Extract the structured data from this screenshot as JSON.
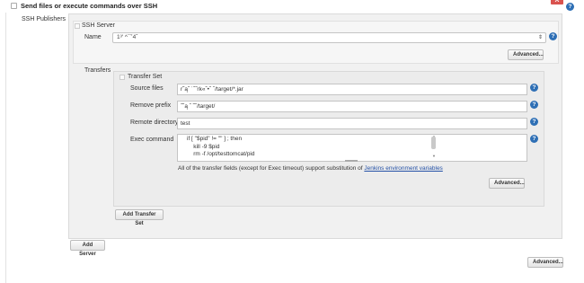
{
  "header": {
    "title": "Send files or execute commands over SSH",
    "close_label": "X"
  },
  "publishers": {
    "label": "SSH Publishers"
  },
  "server": {
    "title": "SSH Server",
    "name_label": "Name",
    "name_value": "1³' ^¯˚4ˆ",
    "advanced_label": "Advanced..."
  },
  "transfers": {
    "label": "Transfers",
    "set_title": "Transfer Set",
    "source_label": "Source files",
    "source_value": "r˜ąˆ ˙ˆ˝rk«ˆ•ˆ ˆ/target/*.jar",
    "remove_label": "Remove prefix",
    "remove_value": "˝ˆą ˆ ˜ˆ/target/",
    "remote_label": "Remote directory",
    "remote_value": "test",
    "exec_label": "Exec command",
    "exec_lines": [
      "if [ \"$pid\" != \"\" ] ; then",
      "    kill -9 $pid",
      "    rm -f /opt/testtomcat/pid"
    ],
    "note_text": "All of the transfer fields (except for Exec timeout) support substitution of ",
    "note_link": "Jenkins environment variables",
    "advanced_label": "Advanced...",
    "add_transfer_label": "Add Transfer Set"
  },
  "add_server_label": "Add Server",
  "bottom_advanced_label": "Advanced...",
  "help_glyph": "?"
}
